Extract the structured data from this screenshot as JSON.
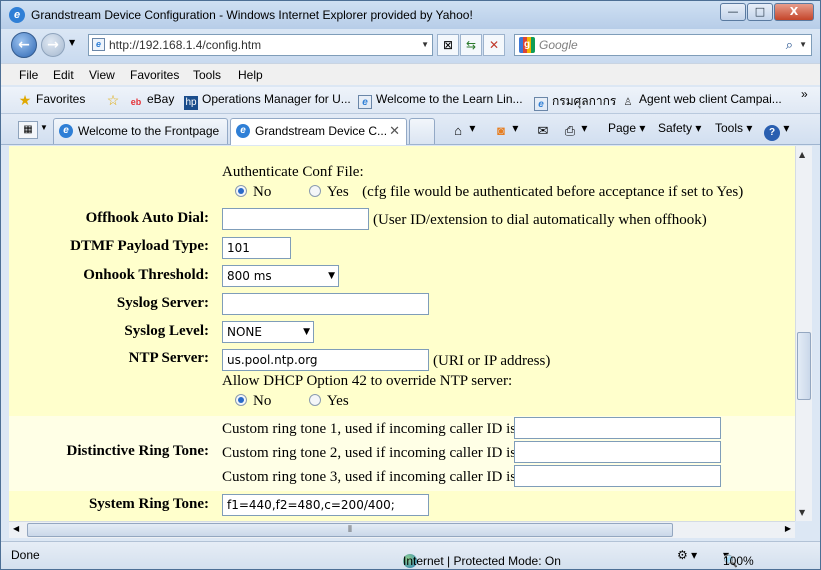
{
  "window": {
    "title": "Grandstream Device Configuration - Windows Internet Explorer provided by Yahoo!",
    "buttons": {
      "minimize": "—",
      "maximize": "□",
      "close": "X"
    }
  },
  "address_bar": {
    "url": "http://192.168.1.4/config.htm",
    "search_placeholder": "Google"
  },
  "menu": [
    "File",
    "Edit",
    "View",
    "Favorites",
    "Tools",
    "Help"
  ],
  "favorites_bar": {
    "favorites_label": "Favorites",
    "items": [
      "eBay",
      "Operations Manager for U...",
      "Welcome to the Learn Lin...",
      "กรมศุลกากร",
      "Agent web client Campai..."
    ]
  },
  "tabs": [
    {
      "label": "Welcome to the Frontpage"
    },
    {
      "label": "Grandstream Device C..."
    }
  ],
  "command_bar": {
    "page": "Page",
    "safety": "Safety",
    "tools": "Tools"
  },
  "config": {
    "auth_conf_label": "Authenticate Conf File:",
    "auth_conf_no": "No",
    "auth_conf_yes": "Yes",
    "auth_conf_note": "(cfg file would be authenticated before acceptance if set to Yes)",
    "offhook_label": "Offhook Auto Dial:",
    "offhook_value": "",
    "offhook_note": "(User ID/extension to dial automatically when offhook)",
    "dtmf_label": "DTMF Payload Type:",
    "dtmf_value": "101",
    "onhook_label": "Onhook Threshold:",
    "onhook_value": "800 ms",
    "syslog_server_label": "Syslog Server:",
    "syslog_server_value": "",
    "syslog_level_label": "Syslog Level:",
    "syslog_level_value": "NONE",
    "ntp_label": "NTP Server:",
    "ntp_value": "us.pool.ntp.org",
    "ntp_note": "(URI or IP address)",
    "dhcp42_label": "Allow DHCP Option 42 to override NTP server:",
    "dhcp42_no": "No",
    "dhcp42_yes": "Yes",
    "ring_label": "Distinctive Ring Tone:",
    "ring1": "Custom ring tone 1, used if incoming caller ID is",
    "ring2": "Custom ring tone 2, used if incoming caller ID is",
    "ring3": "Custom ring tone 3, used if incoming caller ID is",
    "system_ring_label": "System Ring Tone:",
    "system_ring_value": "f1=440,f2=480,c=200/400;"
  },
  "status_bar": {
    "left": "Done",
    "zone": "Internet | Protected Mode: On",
    "zoom": "100%"
  }
}
